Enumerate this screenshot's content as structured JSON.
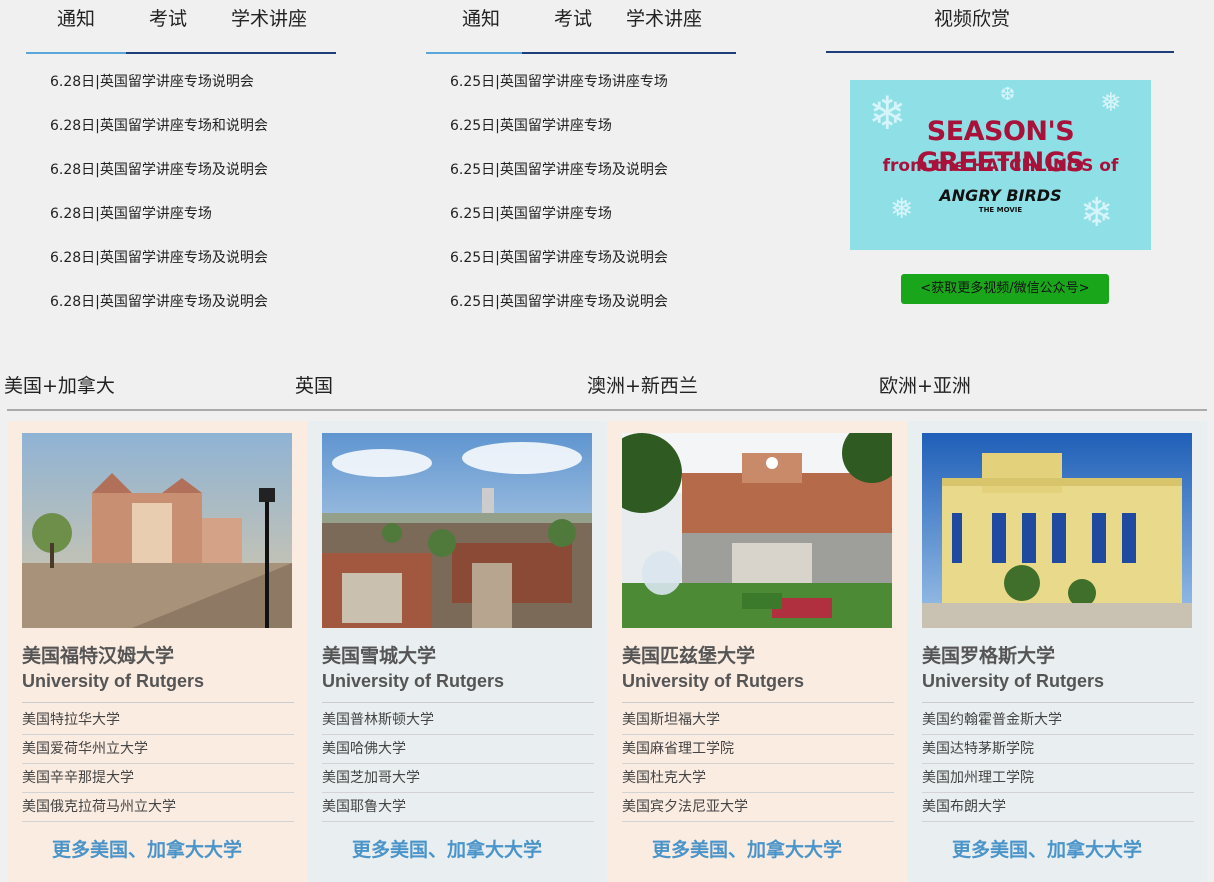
{
  "news_columns": [
    {
      "tabs": [
        "通知",
        "考试",
        "学术讲座"
      ],
      "items": [
        "6.28日|英国留学讲座专场说明会",
        "6.28日|英国留学讲座专场和说明会",
        "6.28日|英国留学讲座专场及说明会",
        "6.28日|英国留学讲座专场",
        "6.28日|英国留学讲座专场及说明会",
        "6.28日|英国留学讲座专场及说明会"
      ]
    },
    {
      "tabs": [
        "通知",
        "考试",
        "学术讲座"
      ],
      "items": [
        "6.25日|英国留学讲座专场讲座专场",
        "6.25日|英国留学讲座专场",
        "6.25日|英国留学讲座专场及说明会",
        "6.25日|英国留学讲座专场",
        "6.25日|英国留学讲座专场及说明会",
        "6.25日|英国留学讲座专场及说明会"
      ]
    }
  ],
  "video": {
    "title": "视频欣赏",
    "thumb_line1": "SEASON'S GREETINGS",
    "thumb_line2": "from the HATCHLINGS of",
    "thumb_line3": "ANGRY BIRDS",
    "thumb_line4": "THE MOVIE",
    "more_button": "<获取更多视频/微信公众号>"
  },
  "regions": [
    "美国+加拿大",
    "英国",
    "澳洲+新西兰",
    "欧洲+亚洲"
  ],
  "universities": [
    {
      "name_cn": "美国福特汉姆大学",
      "name_en": "University of Rutgers",
      "links": [
        "美国特拉华大学",
        "美国爱荷华州立大学",
        "美国辛辛那提大学",
        "美国俄克拉荷马州立大学"
      ],
      "more": "更多美国、加拿大大学"
    },
    {
      "name_cn": "美国雪城大学",
      "name_en": "University of Rutgers",
      "links": [
        "美国普林斯顿大学",
        "美国哈佛大学",
        "美国芝加哥大学",
        "美国耶鲁大学"
      ],
      "more": "更多美国、加拿大大学"
    },
    {
      "name_cn": "美国匹兹堡大学",
      "name_en": "University of Rutgers",
      "links": [
        "美国斯坦福大学",
        "美国麻省理工学院",
        "美国杜克大学",
        "美国宾夕法尼亚大学"
      ],
      "more": "更多美国、加拿大大学"
    },
    {
      "name_cn": "美国罗格斯大学",
      "name_en": "University of Rutgers",
      "links": [
        "美国约翰霍普金斯大学",
        "美国达特茅斯学院",
        "美国加州理工学院",
        "美国布朗大学"
      ],
      "more": "更多美国、加拿大大学"
    }
  ]
}
